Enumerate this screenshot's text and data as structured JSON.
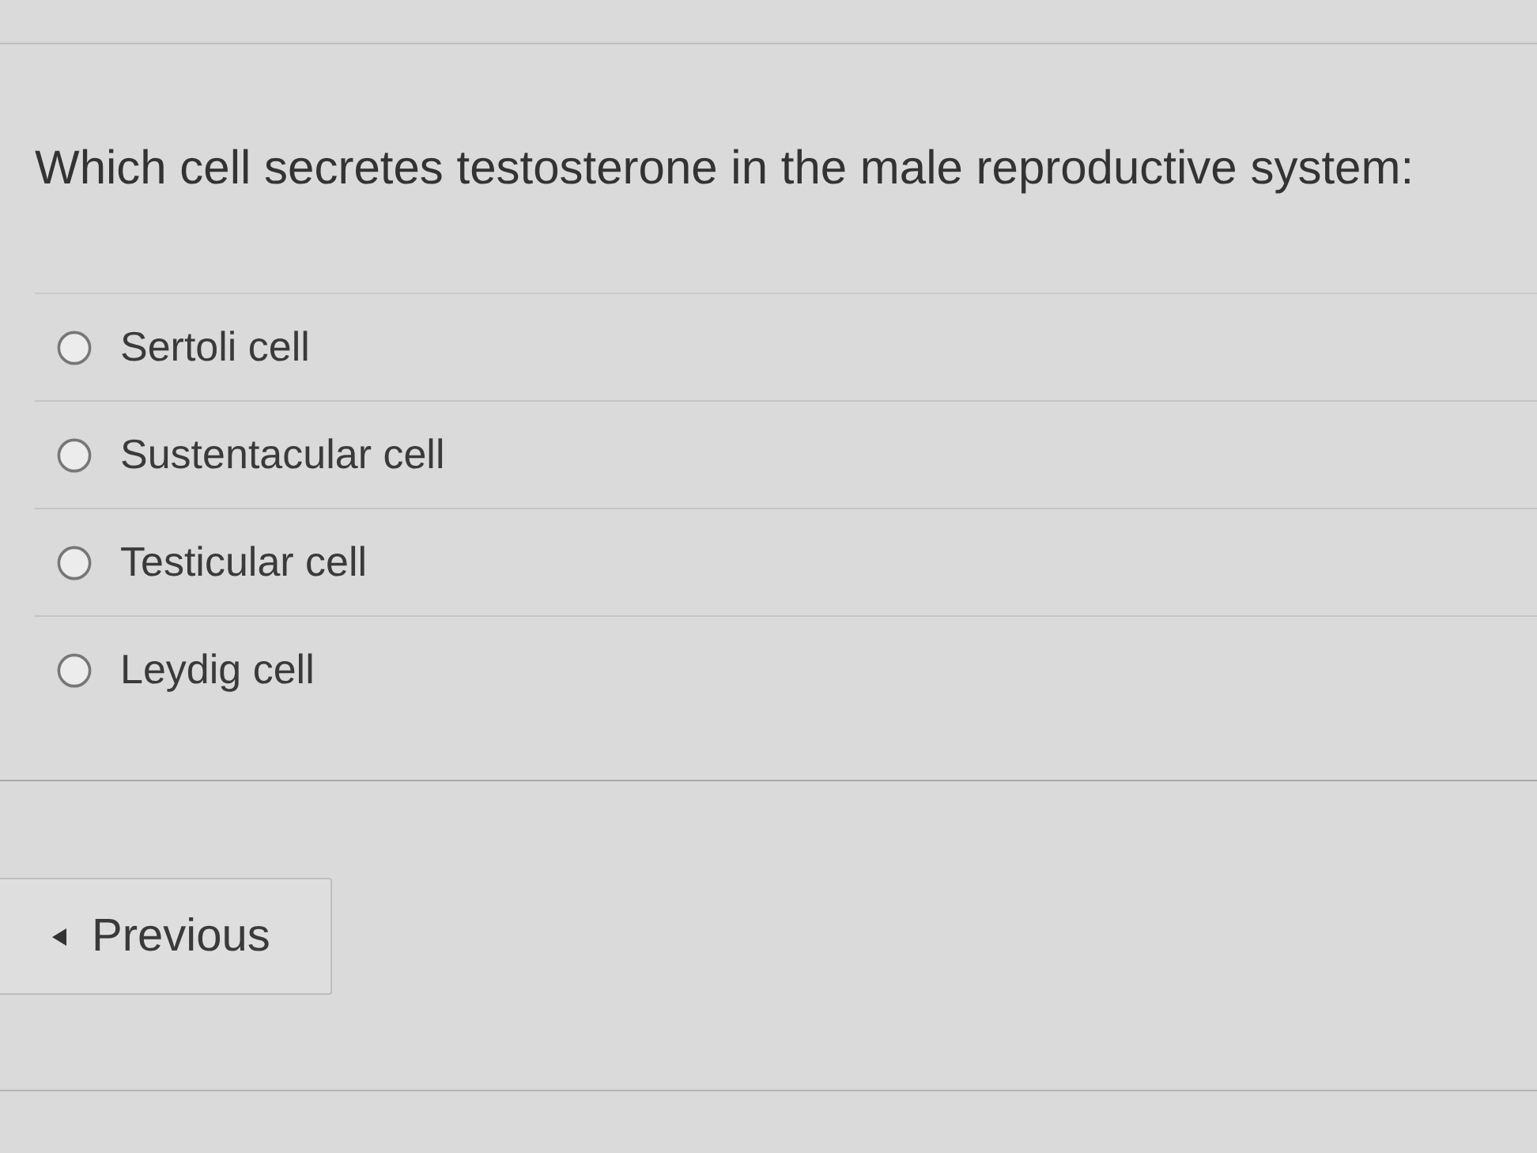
{
  "question": {
    "text": "Which cell secretes testosterone in the male reproductive system:"
  },
  "options": [
    {
      "label": "Sertoli cell",
      "selected": false
    },
    {
      "label": "Sustentacular cell",
      "selected": false
    },
    {
      "label": "Testicular cell",
      "selected": false
    },
    {
      "label": "Leydig cell",
      "selected": false
    }
  ],
  "navigation": {
    "previous_button": {
      "label": "Previous"
    }
  }
}
